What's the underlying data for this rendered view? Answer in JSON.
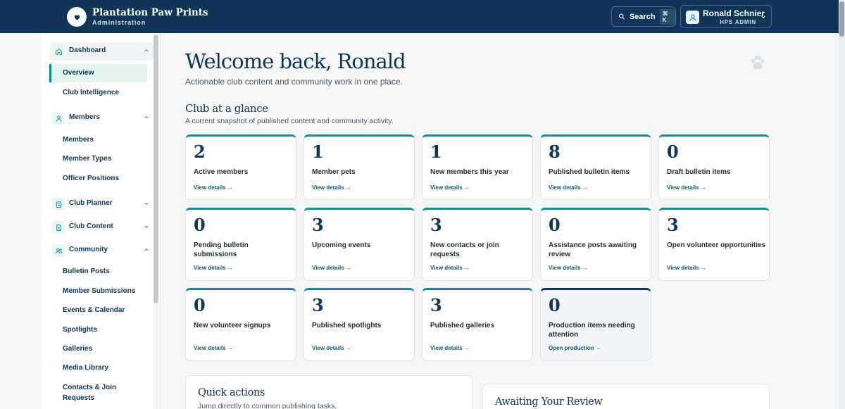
{
  "brand": {
    "name": "Plantation Paw Prints",
    "subtitle": "Administration"
  },
  "header": {
    "search_label": "Search",
    "search_shortcut": "⌘ K",
    "user_name": "Ronald Schnier",
    "user_role": "HPS ADMIN"
  },
  "sidebar": {
    "sections": [
      {
        "label": "Dashboard",
        "icon": "home-icon",
        "items": [
          "Overview",
          "Club Intelligence"
        ]
      },
      {
        "label": "Members",
        "icon": "user-icon",
        "items": [
          "Members",
          "Member Types",
          "Officer Positions"
        ]
      },
      {
        "label": "Club Planner",
        "icon": "clipboard-icon",
        "items": []
      },
      {
        "label": "Club Content",
        "icon": "document-icon",
        "items": []
      },
      {
        "label": "Community",
        "icon": "users-icon",
        "items": [
          "Bulletin Posts",
          "Member Submissions",
          "Events & Calendar",
          "Spotlights",
          "Galleries",
          "Media Library",
          "Contacts & Join Requests"
        ]
      }
    ]
  },
  "main": {
    "title": "Welcome back, Ronald",
    "lead": "Actionable club content and community work in one place.",
    "glance_title": "Club at a glance",
    "glance_subtitle": "A current snapshot of published content and community activity.",
    "cards": [
      {
        "value": "2",
        "label": "Active members",
        "link": "View details →"
      },
      {
        "value": "1",
        "label": "Member pets",
        "link": "View details →"
      },
      {
        "value": "1",
        "label": "New members this year",
        "link": "View details →"
      },
      {
        "value": "8",
        "label": "Published bulletin items",
        "link": "View details →"
      },
      {
        "value": "0",
        "label": "Draft bulletin items",
        "link": "View details →"
      },
      {
        "value": "0",
        "label": "Pending bulletin submissions",
        "link": "View details →"
      },
      {
        "value": "3",
        "label": "Upcoming events",
        "link": "View details →"
      },
      {
        "value": "3",
        "label": "New contacts or join requests",
        "link": "View details →"
      },
      {
        "value": "0",
        "label": "Assistance posts awaiting review",
        "link": "View details →"
      },
      {
        "value": "3",
        "label": "Open volunteer opportunities",
        "link": "View details →"
      },
      {
        "value": "0",
        "label": "New volunteer signups",
        "link": "View details →"
      },
      {
        "value": "3",
        "label": "Published spotlights",
        "link": "View details →"
      },
      {
        "value": "3",
        "label": "Published galleries",
        "link": "View details →"
      },
      {
        "value": "0",
        "label": "Production items needing attention",
        "link": "Open production →"
      }
    ],
    "quick_actions": {
      "title": "Quick actions",
      "subtitle": "Jump directly to common publishing tasks."
    },
    "awaiting": {
      "title": "Awaiting Your Review"
    }
  },
  "colors": {
    "navy": "#0f3557",
    "teal": "#128f96",
    "active_bg": "#e2f3f0"
  }
}
